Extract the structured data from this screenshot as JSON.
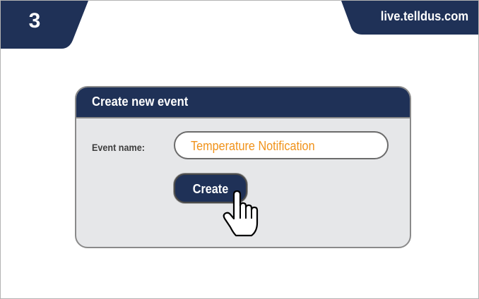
{
  "step": {
    "number": "3"
  },
  "site": {
    "url": "live.telldus.com"
  },
  "dialog": {
    "title": "Create new event",
    "event_name_label": "Event name:",
    "event_name_value": "Temperature Notification",
    "create_button_label": "Create"
  },
  "icons": {
    "cursor": "hand-pointer-icon"
  },
  "colors": {
    "brand_navy": "#1f3157",
    "panel_gray": "#e6e7e9",
    "input_text_orange": "#f0921a"
  }
}
